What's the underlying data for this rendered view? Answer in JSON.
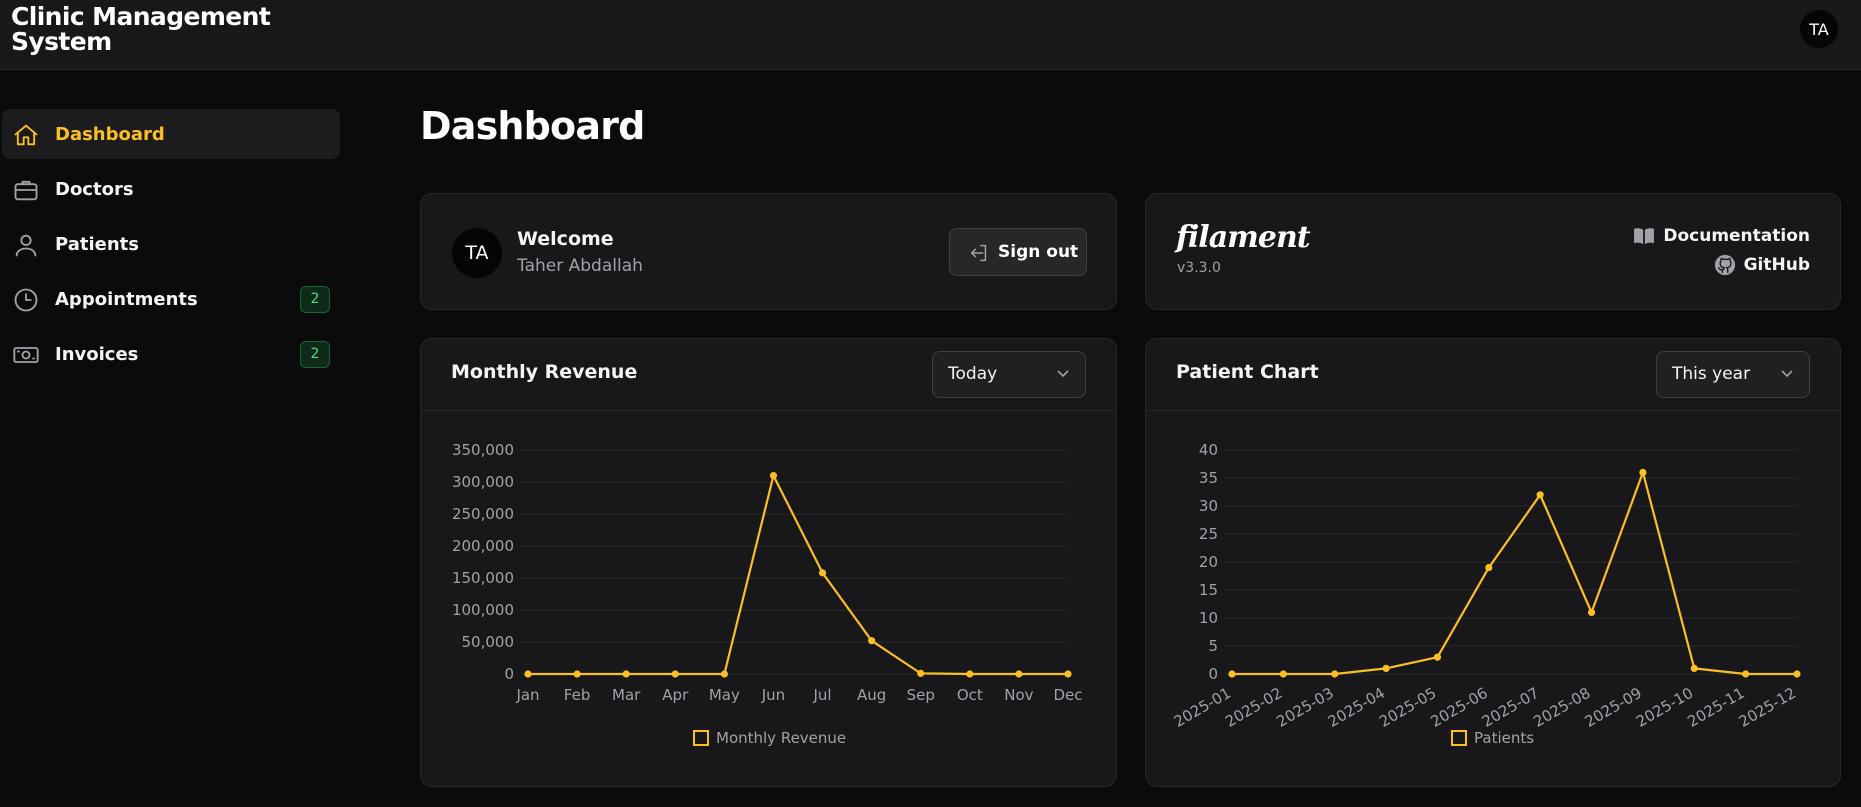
{
  "app": {
    "title": "Clinic Management System",
    "user_initials": "TA"
  },
  "sidebar": {
    "items": [
      {
        "label": "Dashboard",
        "icon": "home-icon",
        "active": true
      },
      {
        "label": "Doctors",
        "icon": "briefcase-icon"
      },
      {
        "label": "Patients",
        "icon": "user-icon"
      },
      {
        "label": "Appointments",
        "icon": "clock-icon",
        "badge": "2"
      },
      {
        "label": "Invoices",
        "icon": "banknotes-icon",
        "badge": "2"
      }
    ]
  },
  "page": {
    "title": "Dashboard"
  },
  "welcome": {
    "title": "Welcome",
    "name": "Taher Abdallah",
    "initials": "TA",
    "signout_label": "Sign out"
  },
  "filament": {
    "logo": "filament",
    "version": "v3.3.0",
    "docs_label": "Documentation",
    "github_label": "GitHub"
  },
  "colors": {
    "accent": "#fbbf24",
    "background": "#0b0b0c",
    "card": "#18181b",
    "badge": "#4ade80"
  },
  "revenue_widget": {
    "title": "Monthly Revenue",
    "filter": "Today"
  },
  "patient_widget": {
    "title": "Patient Chart",
    "filter": "This year"
  },
  "chart_data": [
    {
      "type": "line",
      "title": "Monthly Revenue",
      "categories": [
        "Jan",
        "Feb",
        "Mar",
        "Apr",
        "May",
        "Jun",
        "Jul",
        "Aug",
        "Sep",
        "Oct",
        "Nov",
        "Dec"
      ],
      "series": [
        {
          "name": "Monthly Revenue",
          "values": [
            0,
            0,
            0,
            0,
            0,
            310000,
            158000,
            52000,
            1000,
            0,
            0,
            0
          ]
        }
      ],
      "yticks": [
        "0",
        "50,000",
        "100,000",
        "150,000",
        "200,000",
        "250,000",
        "300,000",
        "350,000"
      ],
      "ylim": [
        0,
        350000
      ],
      "grid": true,
      "legend": "bottom"
    },
    {
      "type": "line",
      "title": "Patient Chart",
      "categories": [
        "2025-01",
        "2025-02",
        "2025-03",
        "2025-04",
        "2025-05",
        "2025-06",
        "2025-07",
        "2025-08",
        "2025-09",
        "2025-10",
        "2025-11",
        "2025-12"
      ],
      "series": [
        {
          "name": "Patients",
          "values": [
            0,
            0,
            0,
            1,
            3,
            19,
            32,
            11,
            36,
            1,
            0,
            0
          ]
        }
      ],
      "yticks": [
        "0",
        "5",
        "10",
        "15",
        "20",
        "25",
        "30",
        "35",
        "40"
      ],
      "ylim": [
        0,
        40
      ],
      "grid": true,
      "legend": "bottom"
    }
  ]
}
